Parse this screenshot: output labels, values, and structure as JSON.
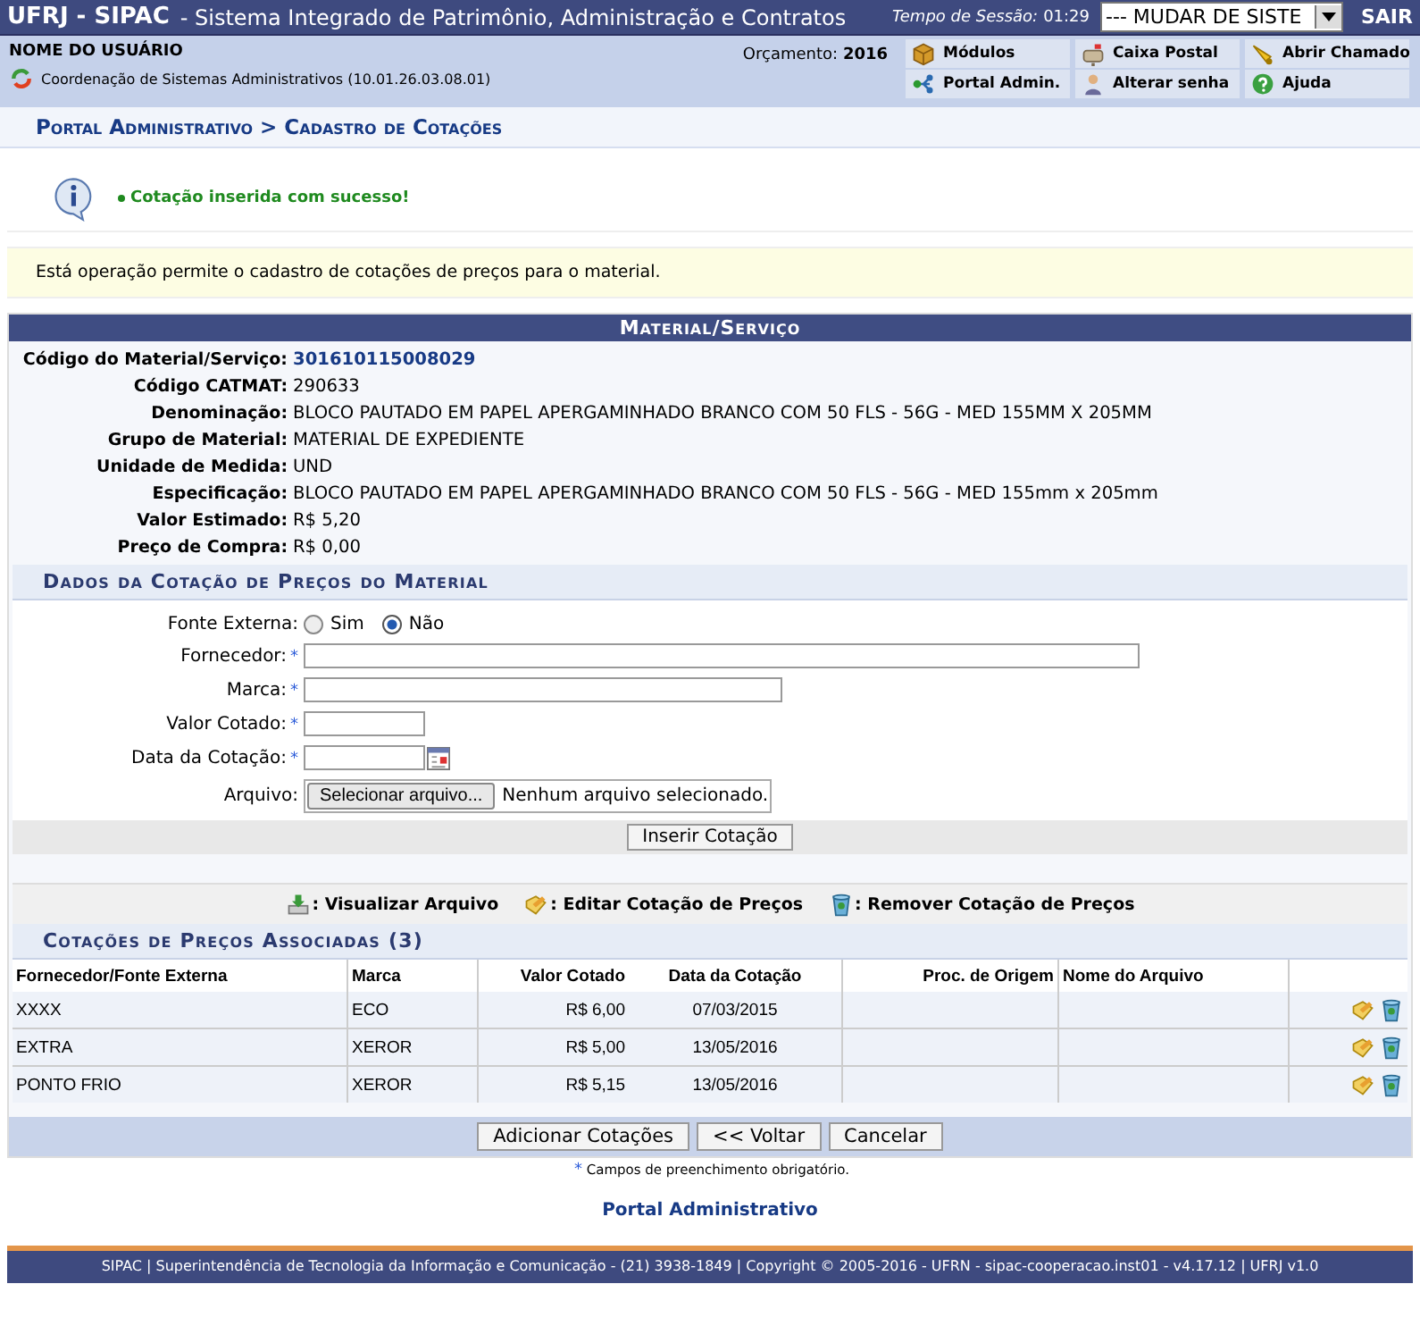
{
  "header": {
    "system_title": "UFRJ - SIPAC",
    "system_subtitle": "- Sistema Integrado de Patrimônio, Administração e Contratos",
    "session_label": "Tempo de Sessão:",
    "session_time": "01:29",
    "system_select": "--- MUDAR DE SISTE",
    "logout": "SAIR"
  },
  "user": {
    "name": "NOME DO USUÁRIO",
    "unit": "Coordenação de Sistemas Administrativos (10.01.26.03.08.01)",
    "budget_label": "Orçamento:",
    "budget_year": "2016"
  },
  "shortcuts": [
    {
      "kind": "modules",
      "label": "Módulos"
    },
    {
      "kind": "mail",
      "label": "Caixa Postal"
    },
    {
      "kind": "ticket",
      "label": "Abrir Chamado"
    },
    {
      "kind": "portal",
      "label": "Portal Admin."
    },
    {
      "kind": "password",
      "label": "Alterar senha"
    },
    {
      "kind": "help",
      "label": "Ajuda"
    }
  ],
  "breadcrumb": "Portal Administrativo > Cadastro de Cotações",
  "message": "Cotação inserida com sucesso!",
  "description": "Está operação permite o cadastro de cotações de preços para o material.",
  "material": {
    "title": "Material/Serviço",
    "fields": [
      {
        "label": "Código do Material/Serviço:",
        "value": "301610115008029",
        "kind": "link"
      },
      {
        "label": "Código CATMAT:",
        "value": "290633",
        "kind": "text"
      },
      {
        "label": "Denominação:",
        "value": "BLOCO PAUTADO EM PAPEL APERGAMINHADO BRANCO COM 50 FLS - 56G - MED 155MM X 205MM",
        "kind": "text"
      },
      {
        "label": "Grupo de Material:",
        "value": "MATERIAL DE EXPEDIENTE",
        "kind": "text"
      },
      {
        "label": "Unidade de Medida:",
        "value": "UND",
        "kind": "text"
      },
      {
        "label": "Especificação:",
        "value": "BLOCO PAUTADO EM PAPEL APERGAMINHADO BRANCO COM 50 FLS - 56G - MED 155mm x 205mm",
        "kind": "text"
      },
      {
        "label": "Valor Estimado:",
        "value": "R$ 5,20",
        "kind": "text"
      },
      {
        "label": "Preço de Compra:",
        "value": "R$ 0,00",
        "kind": "text"
      }
    ]
  },
  "quote_form": {
    "title": "Dados da Cotação de Preços do Material",
    "source": {
      "label": "Fonte Externa:",
      "options": [
        {
          "label": "Sim",
          "selected": false
        },
        {
          "label": "Não",
          "selected": true
        }
      ]
    },
    "fields": [
      {
        "label": "Fornecedor:",
        "kind": "long",
        "required": true
      },
      {
        "label": "Marca:",
        "kind": "medium",
        "required": true
      },
      {
        "label": "Valor Cotado:",
        "kind": "short",
        "required": true
      },
      {
        "label": "Data da Cotação:",
        "kind": "date",
        "required": true
      }
    ],
    "file": {
      "label": "Arquivo:",
      "button": "Selecionar arquivo...",
      "status": "Nenhum arquivo selecionado."
    },
    "submit": "Inserir Cotação"
  },
  "legend": [
    {
      "kind": "view",
      "label": ": Visualizar Arquivo"
    },
    {
      "kind": "edit",
      "label": ": Editar Cotação de Preços"
    },
    {
      "kind": "remove",
      "label": ": Remover Cotação de Preços"
    }
  ],
  "quotes": {
    "title": "Cotações de Preços Associadas (3)",
    "columns": [
      "Fornecedor/Fonte Externa",
      "Marca",
      "Valor Cotado",
      "Data da Cotação",
      "Proc. de Origem",
      "Nome do Arquivo"
    ],
    "rows": [
      {
        "supplier": "XXXX",
        "brand": "ECO",
        "value": "R$ 6,00",
        "date": "07/03/2015"
      },
      {
        "supplier": "EXTRA",
        "brand": "XEROR",
        "value": "R$ 5,00",
        "date": "13/05/2016"
      },
      {
        "supplier": "PONTO FRIO",
        "brand": "XEROR",
        "value": "R$ 5,15",
        "date": "13/05/2016"
      }
    ]
  },
  "actions": [
    "Adicionar Cotações",
    "<< Voltar",
    "Cancelar"
  ],
  "required_note": "Campos de preenchimento obrigatório.",
  "required_mark": "*",
  "portal_link": "Portal Administrativo",
  "footer": "SIPAC | Superintendência de Tecnologia da Informação e Comunicação - (21) 3938-1849 | Copyright © 2005-2016 - UFRN - sipac-cooperacao.inst01 - v4.17.12 | UFRJ v1.0"
}
